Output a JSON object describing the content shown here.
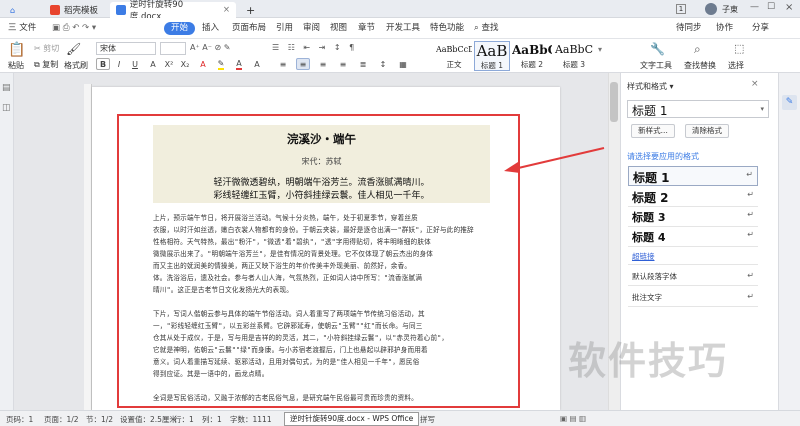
{
  "titlebar": {
    "tabs": [
      {
        "label": "稻壳模板",
        "active": false
      },
      {
        "label": "逆时针旋转90度.docx",
        "active": true
      }
    ],
    "new_tab": "+",
    "badge": "1",
    "user": "子東"
  },
  "menubar": {
    "file": "三 文件",
    "items": [
      "开始",
      "插入",
      "页面布局",
      "引用",
      "审阅",
      "视图",
      "章节",
      "开发工具",
      "特色功能"
    ],
    "search": "查找",
    "right": [
      "待同步",
      "协作",
      "分享"
    ]
  },
  "ribbon": {
    "paste": "粘贴",
    "cut": "剪切",
    "copy": "复制",
    "format_painter": "格式刷",
    "font_name": "宋体",
    "font_size": "",
    "styles": [
      {
        "sample": "AaBbCcDd",
        "label": "正文"
      },
      {
        "sample": "AaB",
        "label": "标题 1"
      },
      {
        "sample": "AaBbC",
        "label": "标题 2"
      },
      {
        "sample": "AaBbC",
        "label": "标题 3"
      }
    ],
    "text_tool": "文字工具",
    "find_replace": "查找替换",
    "select": "选择"
  },
  "document": {
    "title": "浣溪沙・端午",
    "author": "宋代：苏轼",
    "lines": [
      "轻汗微微透碧纨，明朝端午浴芳兰。流香涨腻满晴川。",
      "彩线轻缠红玉臂，小符斜挂绿云鬟。佳人相见一千年。"
    ],
    "para1": [
      "上片，预示端午节日，将开展浴兰活动。气候十分炎热，端午，处于初夏季节，穿着丝质",
      "衣服，以时汗如丝透，嫩白衣裳人物都有的身份。于朝云夹装，最好是逐仓出满一\"群妖\"，正好与此的推辞",
      "性格相符。天气特热，最出\"粉汗\"，\"微透\"着\"碧纨\"，\"透\"字用得贴切，将丰明晰细的肤体",
      "微微展示出来了。\"明朝端午浴芳兰\"，是佳有情况的背景处理。它不仅体现了朝云杰出的身体",
      "而又主出的妩润美的情操美，两正又映下浴生的年价传美丰外现美丽、前然好，余香。",
      "体。洗浴浴后，遗及社会。参与者人山人海，气氛热烈，正如词人诗中所写：\"流香涨腻满",
      "晴川\"。这正是古老节日文化发扬光大的表现。"
    ],
    "para2": [
      "下片，写词人偕朝云参与具体的端午节俗活动。词人着重写了两项端午节传统习俗活动，其",
      "一，\"彩线轻缠红玉臂\"，以五彩丝系臂。它辟邪延寿，使朝云\"玉臂\"\"红\"而长命。与同三",
      "仓其从处于成仪，于是，写与用是吉祥的的灵活，其二，\"小符斜挂绿云鬟\"，以\"赤灵符着心前\"，",
      "它就是神明，佑朝云\"云鬟\"\"绿\"而身康。与小苏宿老渡握后，门上也悬起以辟邪护身而用着",
      "意义。词人着重描写延续、驱邪活动，且用对偶句式，为的是\"佳人相见一千年\"，愿民俗",
      "得到应证。其是一语中的，画龙点睛。"
    ],
    "para3": "全词是写民俗活动，又融于浓郁的古老民俗气息，是研究端午民俗最可贵而珍贵的资料。"
  },
  "styles_pane": {
    "header": "样式和格式 ▾",
    "current_style": "标题 1",
    "new_style_btn": "新样式...",
    "clear_btn": "清除格式",
    "section_title": "请选择要应用的格式",
    "items": [
      {
        "label": "标题 1",
        "size": 13
      },
      {
        "label": "标题 2",
        "size": 12
      },
      {
        "label": "标题 3",
        "size": 11
      },
      {
        "label": "标题 4",
        "size": 11
      },
      {
        "label": "超链接",
        "size": 7.5,
        "link": true
      },
      {
        "label": "默认段落字体",
        "size": 7.5
      },
      {
        "label": "批注文字",
        "size": 7.5
      }
    ]
  },
  "statusbar": {
    "page": "页码：1",
    "pages": "页面：1/2",
    "section": "节：1/2",
    "setting": "设置值：2.5厘米",
    "row": "行：1",
    "col": "列：1",
    "words": "字数：1111",
    "spell": "拼写",
    "tooltip": "逆时针旋转90度.docx - WPS Office"
  },
  "watermark": "软件技巧",
  "colors": {
    "accent": "#3c7ce5",
    "highlight": "#e23b3b",
    "poem_bg": "#f1eedd"
  }
}
